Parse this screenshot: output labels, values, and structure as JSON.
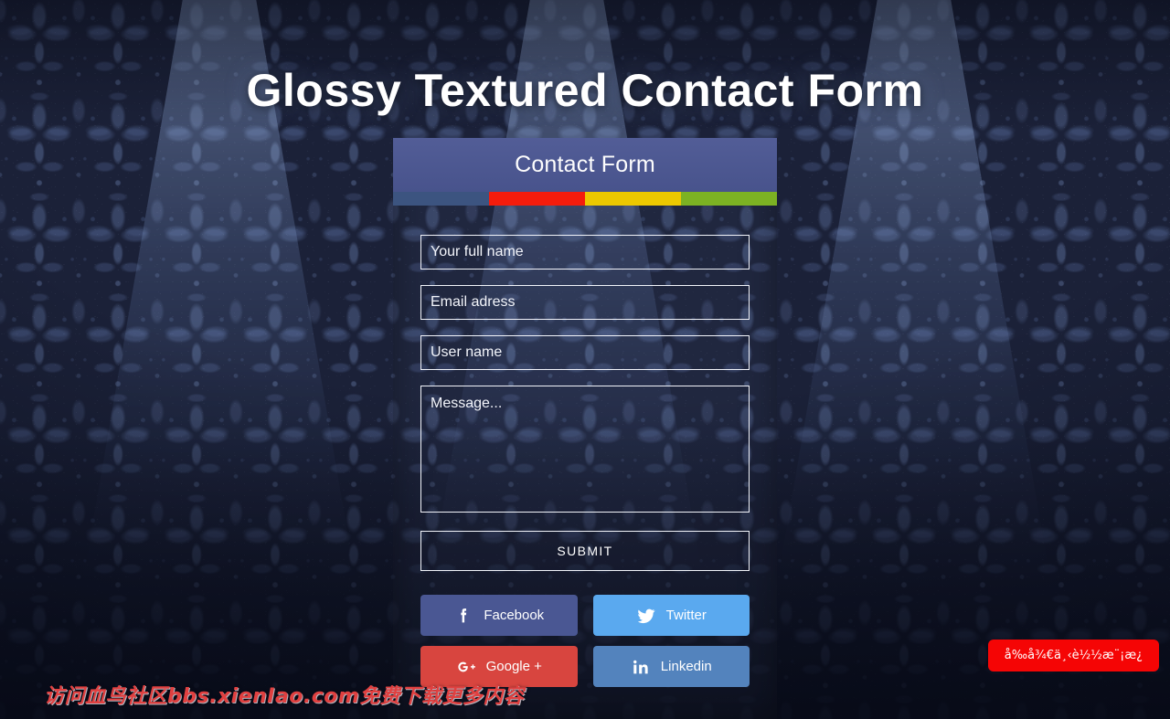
{
  "page": {
    "title": "Glossy Textured Contact Form"
  },
  "form": {
    "header_title": "Contact Form",
    "color_bar": [
      {
        "name": "segment-blue",
        "color": "#3c5480"
      },
      {
        "name": "segment-red",
        "color": "#f41c0c"
      },
      {
        "name": "segment-yellow",
        "color": "#ecc800"
      },
      {
        "name": "segment-green",
        "color": "#7cb223"
      }
    ],
    "fields": [
      {
        "name": "full-name",
        "placeholder": "Your full name",
        "value": ""
      },
      {
        "name": "email",
        "placeholder": "Email adress",
        "value": ""
      },
      {
        "name": "username",
        "placeholder": "User name",
        "value": ""
      }
    ],
    "message": {
      "placeholder": "Message...",
      "value": ""
    },
    "submit_label": "SUBMIT"
  },
  "social": [
    {
      "label": "Facebook",
      "icon": "facebook-icon",
      "color": "#4a5793"
    },
    {
      "label": "Twitter",
      "icon": "twitter-icon",
      "color": "#5aa9ef"
    },
    {
      "label": "Google +",
      "icon": "google-plus-icon",
      "color": "#d8453f"
    },
    {
      "label": "Linkedin",
      "icon": "linkedin-icon",
      "color": "#5383bd"
    }
  ],
  "overlays": {
    "watermark": "访问血鸟社区bbs.xienIao.com免费下载更多内容",
    "corner_badge": "å‰å¾€ä¸‹è½½æ¨¡æ¿"
  },
  "theme": {
    "header_bg": "#4c5791",
    "background": "#1b2138",
    "field_border": "#f2f4fa",
    "text": "#ffffff"
  }
}
